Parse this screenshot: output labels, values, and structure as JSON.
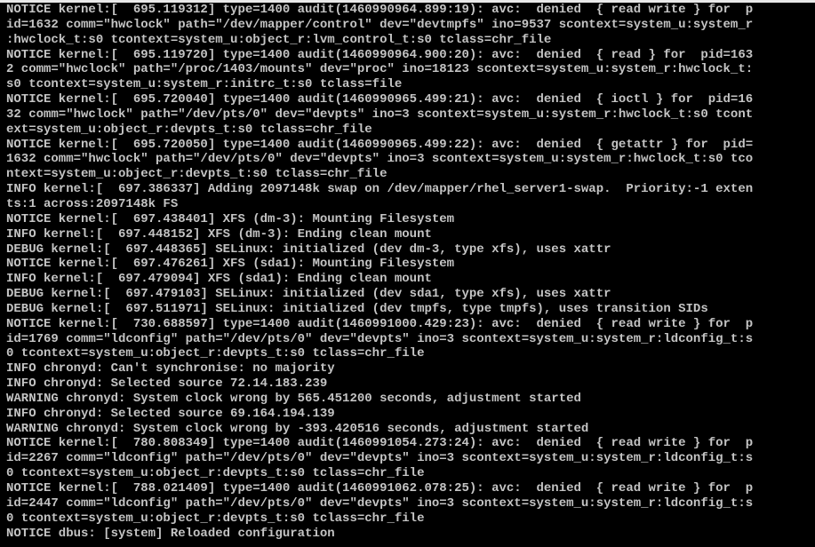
{
  "console": {
    "lines": [
      "NOTICE kernel:[  695.119312] type=1400 audit(1460990964.899:19): avc:  denied  { read write } for  p",
      "id=1632 comm=\"hwclock\" path=\"/dev/mapper/control\" dev=\"devtmpfs\" ino=9537 scontext=system_u:system_r",
      ":hwclock_t:s0 tcontext=system_u:object_r:lvm_control_t:s0 tclass=chr_file",
      "NOTICE kernel:[  695.119720] type=1400 audit(1460990964.900:20): avc:  denied  { read } for  pid=163",
      "2 comm=\"hwclock\" path=\"/proc/1403/mounts\" dev=\"proc\" ino=18123 scontext=system_u:system_r:hwclock_t:",
      "s0 tcontext=system_u:system_r:initrc_t:s0 tclass=file",
      "NOTICE kernel:[  695.720040] type=1400 audit(1460990965.499:21): avc:  denied  { ioctl } for  pid=16",
      "32 comm=\"hwclock\" path=\"/dev/pts/0\" dev=\"devpts\" ino=3 scontext=system_u:system_r:hwclock_t:s0 tcont",
      "ext=system_u:object_r:devpts_t:s0 tclass=chr_file",
      "NOTICE kernel:[  695.720050] type=1400 audit(1460990965.499:22): avc:  denied  { getattr } for  pid=",
      "1632 comm=\"hwclock\" path=\"/dev/pts/0\" dev=\"devpts\" ino=3 scontext=system_u:system_r:hwclock_t:s0 tco",
      "ntext=system_u:object_r:devpts_t:s0 tclass=chr_file",
      "INFO kernel:[  697.386337] Adding 2097148k swap on /dev/mapper/rhel_server1-swap.  Priority:-1 exten",
      "ts:1 across:2097148k FS",
      "NOTICE kernel:[  697.438401] XFS (dm-3): Mounting Filesystem",
      "INFO kernel:[  697.448152] XFS (dm-3): Ending clean mount",
      "DEBUG kernel:[  697.448365] SELinux: initialized (dev dm-3, type xfs), uses xattr",
      "NOTICE kernel:[  697.476261] XFS (sda1): Mounting Filesystem",
      "INFO kernel:[  697.479094] XFS (sda1): Ending clean mount",
      "DEBUG kernel:[  697.479103] SELinux: initialized (dev sda1, type xfs), uses xattr",
      "DEBUG kernel:[  697.511971] SELinux: initialized (dev tmpfs, type tmpfs), uses transition SIDs",
      "NOTICE kernel:[  730.688597] type=1400 audit(1460991000.429:23): avc:  denied  { read write } for  p",
      "id=1769 comm=\"ldconfig\" path=\"/dev/pts/0\" dev=\"devpts\" ino=3 scontext=system_u:system_r:ldconfig_t:s",
      "0 tcontext=system_u:object_r:devpts_t:s0 tclass=chr_file",
      "INFO chronyd: Can't synchronise: no majority",
      "INFO chronyd: Selected source 72.14.183.239",
      "WARNING chronyd: System clock wrong by 565.451200 seconds, adjustment started",
      "INFO chronyd: Selected source 69.164.194.139",
      "WARNING chronyd: System clock wrong by -393.420516 seconds, adjustment started",
      "NOTICE kernel:[  780.808349] type=1400 audit(1460991054.273:24): avc:  denied  { read write } for  p",
      "id=2267 comm=\"ldconfig\" path=\"/dev/pts/0\" dev=\"devpts\" ino=3 scontext=system_u:system_r:ldconfig_t:s",
      "0 tcontext=system_u:object_r:devpts_t:s0 tclass=chr_file",
      "NOTICE kernel:[  788.021409] type=1400 audit(1460991062.078:25): avc:  denied  { read write } for  p",
      "id=2447 comm=\"ldconfig\" path=\"/dev/pts/0\" dev=\"devpts\" ino=3 scontext=system_u:system_r:ldconfig_t:s",
      "0 tcontext=system_u:object_r:devpts_t:s0 tclass=chr_file",
      "NOTICE dbus: [system] Reloaded configuration"
    ]
  },
  "colors": {
    "background": "#000000",
    "text": "#c4c4c4"
  }
}
